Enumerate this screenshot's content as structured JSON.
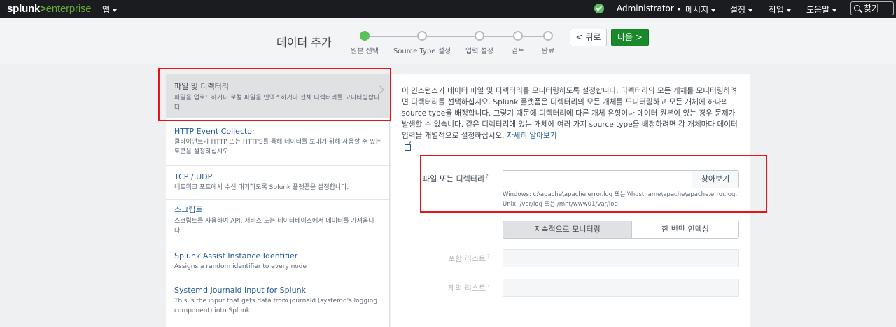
{
  "topbar": {
    "logo": {
      "brand": "splunk",
      "gt": ">",
      "product": "enterprise"
    },
    "app_menu": "앱",
    "status_icon": "check-circle-icon",
    "user_menu": "Administrator",
    "messages_menu": "메시지",
    "settings_menu": "설정",
    "activity_menu": "작업",
    "help_menu": "도움말",
    "search_label": "찾기"
  },
  "wizard": {
    "title": "데이터 추가",
    "steps": [
      {
        "label": "원본 선택",
        "active": true
      },
      {
        "label": "Source Type 설정",
        "active": false
      },
      {
        "label": "입력 설정",
        "active": false
      },
      {
        "label": "검토",
        "active": false
      },
      {
        "label": "완료",
        "active": false
      }
    ],
    "back_label": "< 뒤로",
    "next_label": "다음 >"
  },
  "sources": [
    {
      "title": "파일 및 디렉터리",
      "desc": "파일을 업로드하거나 로컬 파일을 인덱스하거나 전체 디렉터리를 모니터링합니다.",
      "selected": true
    },
    {
      "title": "HTTP Event Collector",
      "desc": "클라이언트가 HTTP 또는 HTTPS를 통해 데이터를 보내기 위해 사용할 수 있는 토큰을 설정하십시오."
    },
    {
      "title": "TCP / UDP",
      "desc": "네트워크 포트에서 수신 대기하도록 Splunk 플랫폼을 설정합니다."
    },
    {
      "title": "스크립트",
      "desc": "스크립트를 사용하여 API, 서비스 또는 데이터베이스에서 데이터를 가져옵니다."
    },
    {
      "title": "Splunk Assist Instance Identifier",
      "desc": "Assigns a random identifier to every node"
    },
    {
      "title": "Systemd Journald Input for Splunk",
      "desc": "This is the input that gets data from journald (systemd's logging component) into Splunk."
    }
  ],
  "panel": {
    "intro": "이 인스턴스가 데이터 파일 및 디렉터리를 모니터링하도록 설정합니다. 디렉터리의 모든 개체를 모니터링하려면 디렉터리를 선택하십시오. Splunk 플랫폼은 디렉터리의 모든 개체를 모니터링하고 모든 개체에 하나의 source type을 배정합니다. 그렇기 때문에 디렉터리에 다른 개체 유형이나 데이터 원본이 있는 경우 문제가 발생할 수 있습니다. 같은 디렉터리에 있는 개체에 여러 가지 source type을 배정하려면 각 개체마다 데이터 입력을 개별적으로 설정하십시오.",
    "learn_more": "자세히 알아보기",
    "file_label": "파일 또는 디렉터리",
    "file_value": "",
    "browse_label": "찾아보기",
    "help_windows": "Windows: c:\\apache\\apache.error.log 또는 \\\\hostname\\apache\\apache.error.log.",
    "help_unix": "Unix: /var/log 또는 /mnt/www01/var/log",
    "monitor_continuous": "지속적으로 모니터링",
    "index_once": "한 번만 인덱싱",
    "whitelist_label": "포함 리스트",
    "whitelist_value": "",
    "blacklist_label": "제외 리스트",
    "blacklist_value": "",
    "help_mark": "?"
  },
  "colors": {
    "accent_green": "#5cc05c",
    "next_button": "#1a8929",
    "link": "#1e5a94",
    "highlight_box": "#e8121b"
  }
}
